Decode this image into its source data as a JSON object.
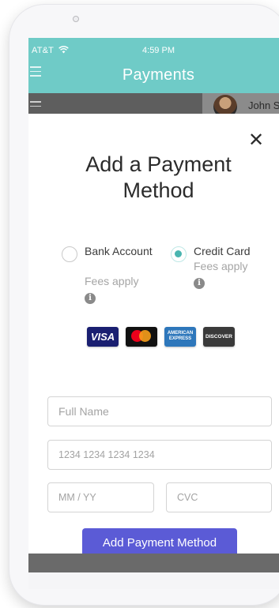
{
  "status_bar": {
    "carrier": "AT&T",
    "time": "4:59 PM"
  },
  "app_bar": {
    "title": "Payments"
  },
  "user": {
    "name": "John S."
  },
  "modal": {
    "title": "Add a Payment Method",
    "close_symbol": "✕",
    "options": [
      {
        "label": "Bank Account",
        "fees": "Fees apply",
        "selected": false
      },
      {
        "label": "Credit Card",
        "fees": "Fees apply",
        "selected": true
      }
    ],
    "card_brands": {
      "visa": "VISA",
      "amex": "AMERICAN EXPRESS",
      "discover": "DISCOVER"
    },
    "fields": {
      "full_name_placeholder": "Full Name",
      "card_number_placeholder": "1234 1234 1234 1234",
      "expiry_placeholder": "MM / YY",
      "cvc_placeholder": "CVC"
    },
    "submit_label": "Add Payment Method"
  },
  "colors": {
    "app_bar": "#6fcbc7",
    "radio_selected": "#49b5b0",
    "button": "#5b5bd6"
  },
  "icons": {
    "menu": "hamburger-menu-icon",
    "wifi": "wifi-icon",
    "close": "close-icon",
    "info": "info-icon"
  }
}
